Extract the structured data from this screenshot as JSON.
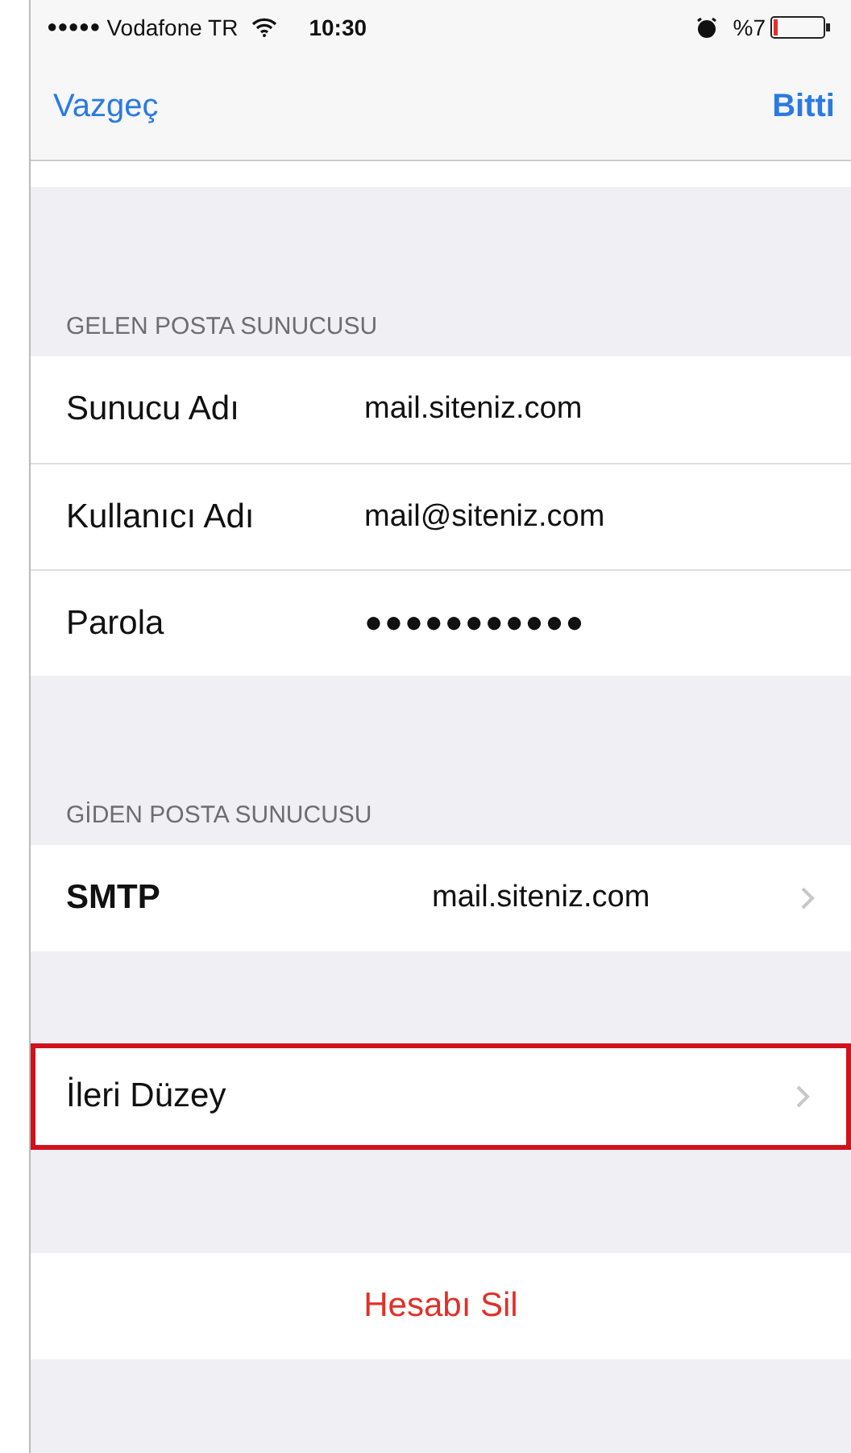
{
  "status_bar": {
    "signal_dots": "●●●●●",
    "carrier": "Vodafone TR",
    "time": "10:30",
    "battery": "%7"
  },
  "nav": {
    "left": "Vazgeç",
    "right": "Bitti"
  },
  "sections": [
    {
      "header": "GELEN POSTA SUNUCUSU",
      "rows": [
        {
          "kind": "field",
          "label": "Sunucu Adı",
          "value": "mail.siteniz.com",
          "highlighted": false
        },
        {
          "kind": "field",
          "label": "Kullanıcı Adı",
          "value": "mail@siteniz.com",
          "highlighted": false
        },
        {
          "kind": "password",
          "label": "Parola",
          "value": "●●●●●●●●●●●",
          "highlighted": false
        }
      ]
    },
    {
      "header": "GİDEN POSTA SUNUCUSU",
      "rows": [
        {
          "kind": "link",
          "label": "SMTP",
          "value": "mail.siteniz.com",
          "highlighted": false
        }
      ]
    },
    {
      "rows": [
        {
          "kind": "link",
          "label": "İleri Düzey",
          "highlighted": true
        }
      ]
    },
    {
      "rows": [
        {
          "kind": "destructive",
          "label": "Hesabı Sil",
          "highlighted": false
        }
      ]
    }
  ]
}
